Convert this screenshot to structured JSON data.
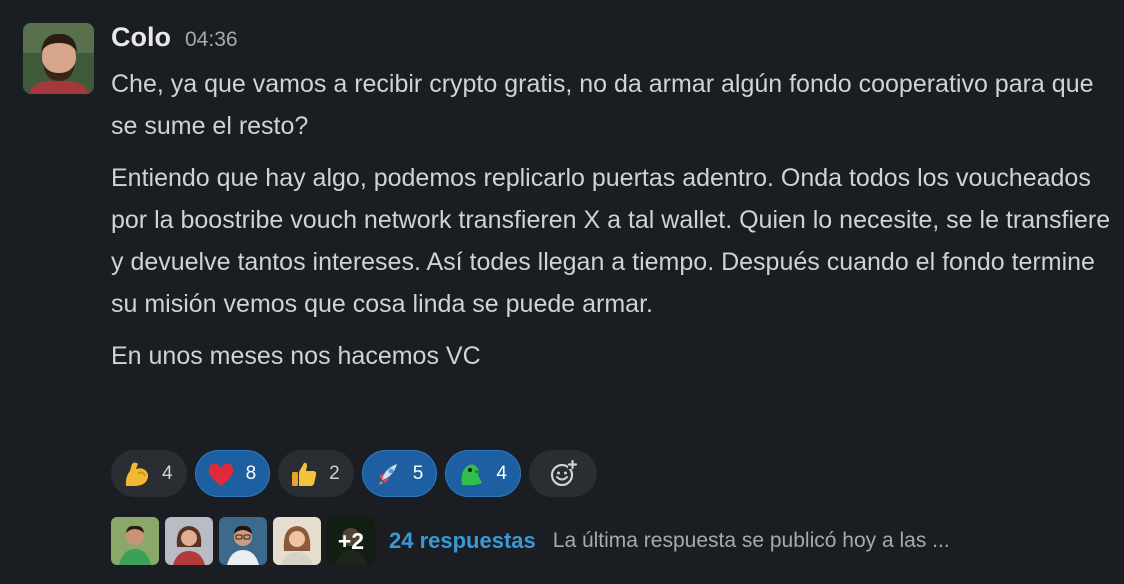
{
  "message": {
    "author": "Colo",
    "time": "04:36",
    "paragraphs": [
      "Che, ya que vamos a recibir crypto gratis, no da armar algún fondo cooperativo para que se sume el resto?",
      "Entiendo que hay algo, podemos replicarlo puertas adentro. Onda todos los voucheados por la boostribe vouch network transfieren X a tal wallet. Quien lo necesite, se le transfiere y devuelve tantos intereses. Así todes llegan a tiempo. Después cuando el fondo termine su misión vemos que cosa linda se puede armar.",
      "En unos meses nos hacemos VC"
    ]
  },
  "reactions": [
    {
      "emoji": "flexed-biceps",
      "count": "4",
      "active": false
    },
    {
      "emoji": "red-heart",
      "count": "8",
      "active": true
    },
    {
      "emoji": "thumbs-up",
      "count": "2",
      "active": false
    },
    {
      "emoji": "rocket",
      "count": "5",
      "active": true
    },
    {
      "emoji": "green-parrot",
      "count": "4",
      "active": true
    }
  ],
  "add_reaction_icon": "add-reaction-icon",
  "thread": {
    "more_count": "+2",
    "replies_label": "24 respuestas",
    "last_reply": "La última respuesta se publicó hoy a las ..."
  },
  "colors": {
    "background": "#1a1d21",
    "link": "#3a9ad9",
    "reaction_active": "#1d5fa0",
    "reaction_inactive": "#2a2d31"
  }
}
